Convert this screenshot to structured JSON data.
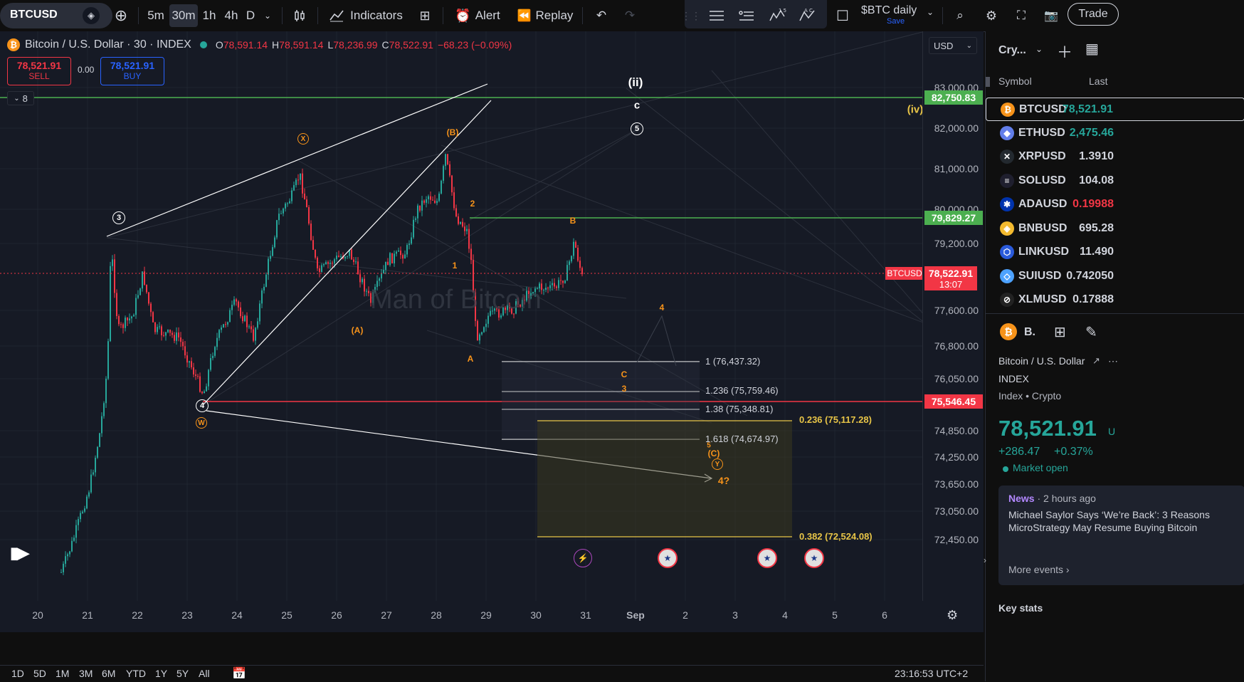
{
  "toolbar": {
    "symbol": "BTCUSD",
    "intervals": [
      "5m",
      "30m",
      "1h",
      "4h",
      "D"
    ],
    "active_interval": "30m",
    "indicators_label": "Indicators",
    "alert_label": "Alert",
    "replay_label": "Replay",
    "layout_name": "$BTC daily",
    "layout_save": "Save",
    "trade_label": "Trade"
  },
  "legend": {
    "title": "Bitcoin / U.S. Dollar · 30 · INDEX",
    "o_label": "O",
    "o_value": "78,591.14",
    "h_label": "H",
    "h_value": "78,591.14",
    "l_label": "L",
    "l_value": "78,236.99",
    "c_label": "C",
    "c_value": "78,522.91",
    "change": "−68.23 (−0.09%)",
    "sell_price": "78,521.91",
    "sell_label": "SELL",
    "spread": "0.00",
    "buy_price": "78,521.91",
    "buy_label": "BUY",
    "indicator_count": "8"
  },
  "chart": {
    "currency": "USD",
    "watermark": "Man of Bitcoin",
    "price_labels": [
      "83,000.00",
      "82,000.00",
      "81,000.00",
      "80,000.00",
      "79,200.00",
      "77,600.00",
      "76,800.00",
      "76,050.00",
      "74,850.00",
      "74,250.00",
      "73,650.00",
      "73,050.00",
      "72,450.00"
    ],
    "tag_green_top": "82,750.83",
    "tag_green_mid": "79,829.27",
    "tag_red_low": "75,546.45",
    "tag_current": "78,522.91",
    "tag_countdown": "13:07",
    "tag_symbol": "BTCUSD",
    "wave_ii": "(ii)",
    "wave_c": "c",
    "wave_iv": "(iv)",
    "time_labels": [
      "20",
      "21",
      "22",
      "23",
      "24",
      "25",
      "26",
      "27",
      "28",
      "29",
      "30",
      "31",
      "Sep",
      "2",
      "3",
      "4",
      "5",
      "6"
    ],
    "fib_white": [
      "1 (76,437.32)",
      "1.236 (75,759.46)",
      "1.38 (75,348.81)",
      "1.618 (74,674.97)"
    ],
    "fib_gold": [
      "0.236 (75,117.28)",
      "0.382 (72,524.08)"
    ],
    "annotations": {
      "X": "X",
      "B_paren": "(B)",
      "A_paren": "(A)",
      "two": "2",
      "one": "1",
      "A": "A",
      "B": "B",
      "four": "4",
      "C": "C",
      "three": "3",
      "five": "5",
      "C_paren": "(C)",
      "Y": "Y",
      "four_q": "4?",
      "W": "W",
      "circ3": "3",
      "circ4": "4",
      "circ5": "5"
    }
  },
  "bottom": {
    "ranges": [
      "1D",
      "5D",
      "1M",
      "3M",
      "6M",
      "YTD",
      "1Y",
      "5Y",
      "All"
    ],
    "clock": "23:16:53 UTC+2"
  },
  "watchlist": {
    "name": "Cry...",
    "col_symbol": "Symbol",
    "col_last": "Last",
    "rows": [
      {
        "symbol": "BTCUSD",
        "last": "78,521.91",
        "color": "#f7931a",
        "glyph": "₿"
      },
      {
        "symbol": "ETHUSD",
        "last": "2,475.46",
        "color": "#627eea",
        "glyph": "◆"
      },
      {
        "symbol": "XRPUSD",
        "last": "1.3910",
        "color": "#23292f",
        "glyph": "✕"
      },
      {
        "symbol": "SOLUSD",
        "last": "104.08",
        "color": "#1f1f2e",
        "glyph": "≡"
      },
      {
        "symbol": "ADAUSD",
        "last": "0.19988",
        "color": "#0033ad",
        "glyph": "✱"
      },
      {
        "symbol": "BNBUSD",
        "last": "695.28",
        "color": "#f3ba2f",
        "glyph": "◈"
      },
      {
        "symbol": "LINKUSD",
        "last": "11.490",
        "color": "#2a5ada",
        "glyph": "⬡"
      },
      {
        "symbol": "SUIUSD",
        "last": "0.742050",
        "color": "#4da2ff",
        "glyph": "◇"
      },
      {
        "symbol": "XLMUSD",
        "last": "0.17888",
        "color": "#222",
        "glyph": "⊘"
      }
    ],
    "last_colors": [
      "#26a69a",
      "#26a69a",
      "#d1d4dc",
      "#d1d4dc",
      "#f23645",
      "#d1d4dc",
      "#d1d4dc",
      "#d1d4dc",
      "#d1d4dc"
    ]
  },
  "details": {
    "symbol_short": "B.",
    "name": "Bitcoin / U.S. Dollar",
    "exchange": "INDEX",
    "category": "Index • Crypto",
    "price": "78,521.91",
    "price_unit": "U",
    "change": "+286.47",
    "change_pct": "+0.37%",
    "status": "Market open",
    "news_label": "News",
    "news_time": "· 2 hours ago",
    "news_text": "Michael Saylor Says ‘We’re Back’: 3 Reasons MicroStrategy May Resume Buying Bitcoin",
    "more_events": "More events ›",
    "key_stats": "Key stats"
  },
  "colors": {
    "up": "#26a69a",
    "down": "#f23645",
    "green_line": "#4caf50",
    "red_line": "#f23645",
    "gold": "#e8c547",
    "orange": "#f7931a"
  }
}
